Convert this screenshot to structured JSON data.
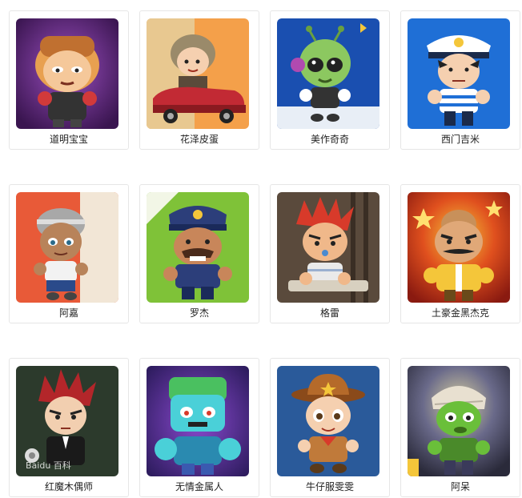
{
  "characters": [
    {
      "name": "道明宝宝",
      "bg": "#6b2f86",
      "accent": "#f2a44a"
    },
    {
      "name": "花泽皮蛋",
      "bg": "#f4a04a",
      "accent": "#d0303a"
    },
    {
      "name": "美作奇奇",
      "bg": "#1a4fb0",
      "accent": "#7ed04a"
    },
    {
      "name": "西门吉米",
      "bg": "#1f6fd6",
      "accent": "#ffffff"
    },
    {
      "name": "阿嘉",
      "bg": "#e85a38",
      "accent": "#f2c9a0"
    },
    {
      "name": "罗杰",
      "bg": "#7fc238",
      "accent": "#2c3e7a"
    },
    {
      "name": "格雷",
      "bg": "#5a4a3c",
      "accent": "#d83a2a"
    },
    {
      "name": "土豪金黑杰克",
      "bg": "#d8321e",
      "accent": "#f4c63a"
    },
    {
      "name": "红魔木偶师",
      "bg": "#2c3a2c",
      "accent": "#b3262a"
    },
    {
      "name": "无情金属人",
      "bg": "#3a2a6e",
      "accent": "#4ad0d8"
    },
    {
      "name": "牛仔服雯雯",
      "bg": "#2a5a9a",
      "accent": "#b56a2a"
    },
    {
      "name": "阿呆",
      "bg": "#3a3a5a",
      "accent": "#6abf3a"
    }
  ],
  "watermark_text": "Baidu 百科"
}
